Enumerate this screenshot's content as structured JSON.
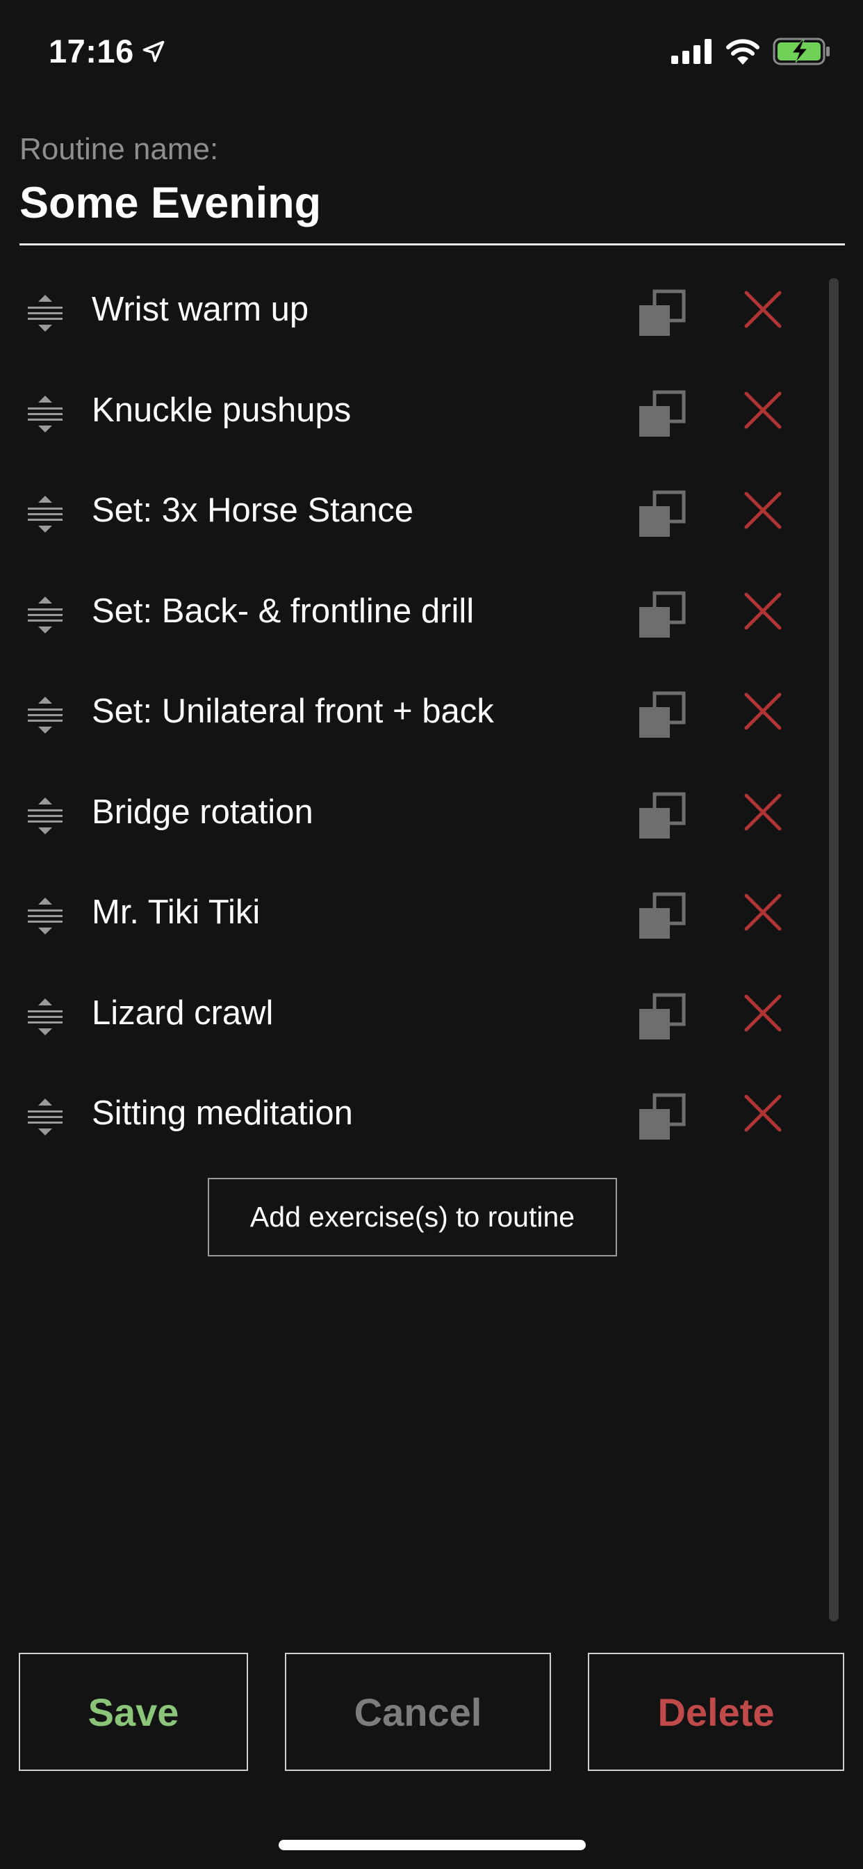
{
  "status_bar": {
    "time": "17:16",
    "location_icon": "location-arrow-icon",
    "signal_icon": "cellular-signal-icon",
    "wifi_icon": "wifi-icon",
    "battery_icon": "battery-charging-icon"
  },
  "routine": {
    "name_label": "Routine name:",
    "name_value": "Some Evening"
  },
  "exercises": [
    {
      "label": "Wrist warm up"
    },
    {
      "label": "Knuckle pushups"
    },
    {
      "label": "Set: 3x Horse Stance"
    },
    {
      "label": "Set: Back- & frontline drill"
    },
    {
      "label": "Set: Unilateral front + back"
    },
    {
      "label": "Bridge rotation"
    },
    {
      "label": "Mr. Tiki Tiki"
    },
    {
      "label": "Lizard crawl"
    },
    {
      "label": "Sitting meditation"
    }
  ],
  "add_exercise_label": "Add exercise(s) to routine",
  "actions": {
    "save_label": "Save",
    "cancel_label": "Cancel",
    "delete_label": "Delete"
  },
  "colors": {
    "background": "#131313",
    "save": "#8bc57a",
    "cancel": "#7c7c7c",
    "delete": "#c04a4a",
    "delete_icon": "#b03434",
    "copy_icon": "#6e6e6e",
    "drag_handle": "#9a9a9a"
  }
}
